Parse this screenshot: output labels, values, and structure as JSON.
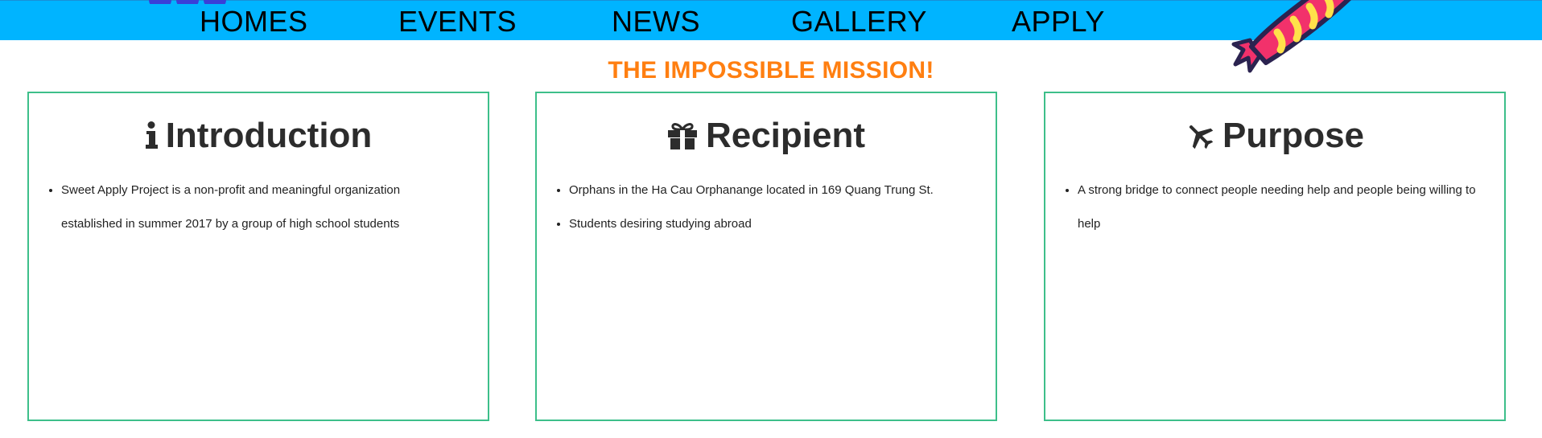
{
  "nav": {
    "items": [
      {
        "label": "HOMES"
      },
      {
        "label": "EVENTS"
      },
      {
        "label": "NEWS"
      },
      {
        "label": "GALLERY"
      },
      {
        "label": "APPLY"
      }
    ]
  },
  "decorations": {
    "logo_icon": "logo-fragment",
    "candy_icon": "candy-icon"
  },
  "main": {
    "title": "THE IMPOSSIBLE MISSION!",
    "cards": [
      {
        "icon": "info-icon",
        "heading": "Introduction",
        "items": [
          "Sweet Apply Project is a non-profit and meaningful organization established in summer 2017 by a group of high school students"
        ]
      },
      {
        "icon": "gift-icon",
        "heading": "Recipient",
        "items": [
          "Orphans in the Ha Cau Orphanange located in 169 Quang Trung St.",
          "Students desiring studying abroad"
        ]
      },
      {
        "icon": "plane-icon",
        "heading": "Purpose",
        "items": [
          "A strong bridge to connect people needing help and people being willing to help"
        ]
      }
    ]
  },
  "colors": {
    "navbar": "#00b4ff",
    "title": "#ff7f11",
    "card_border": "#3dbf8a",
    "text": "#2c2c2c"
  }
}
